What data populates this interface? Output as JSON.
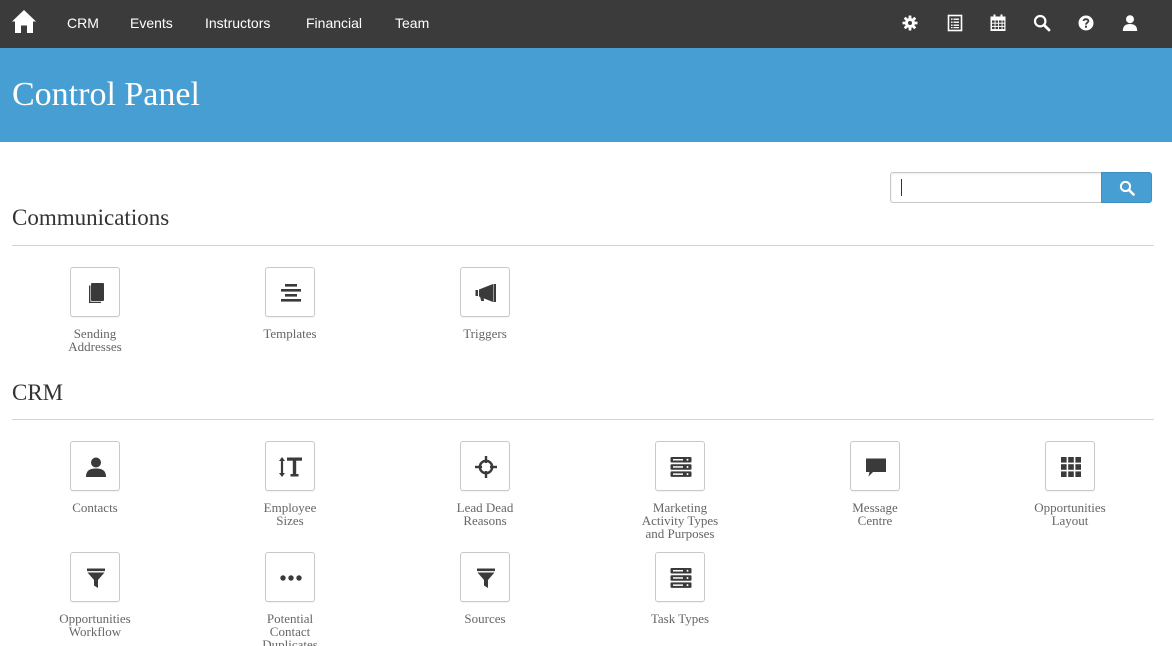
{
  "nav": {
    "home_icon": "home-icon",
    "links": [
      "CRM",
      "Events",
      "Instructors",
      "Financial",
      "Team"
    ],
    "right_icons": [
      "gear-icon",
      "list-icon",
      "calendar-icon",
      "search-icon",
      "help-icon",
      "user-icon"
    ]
  },
  "header": {
    "title": "Control Panel"
  },
  "search": {
    "value": "",
    "placeholder": "",
    "button_icon": "search-icon"
  },
  "sections": [
    {
      "title": "Communications",
      "items": [
        {
          "lines": [
            "Sending",
            "Addresses"
          ],
          "icon": "book-icon"
        },
        {
          "lines": [
            "Templates"
          ],
          "icon": "align-center-icon"
        },
        {
          "lines": [
            "Triggers"
          ],
          "icon": "megaphone-icon"
        }
      ]
    },
    {
      "title": "CRM",
      "items": [
        {
          "lines": [
            "Contacts"
          ],
          "icon": "user-icon"
        },
        {
          "lines": [
            "Employee",
            "Sizes"
          ],
          "icon": "text-height-icon"
        },
        {
          "lines": [
            "Lead Dead",
            "Reasons"
          ],
          "icon": "crosshairs-icon"
        },
        {
          "lines": [
            "Marketing",
            "Activity Types",
            "and Purposes"
          ],
          "icon": "server-icon"
        },
        {
          "lines": [
            "Message",
            "Centre"
          ],
          "icon": "comment-icon"
        },
        {
          "lines": [
            "Opportunities",
            "Layout"
          ],
          "icon": "grid-icon"
        },
        {
          "lines": [
            "Opportunities",
            "Workflow"
          ],
          "icon": "filter-icon"
        },
        {
          "lines": [
            "Potential",
            "Contact",
            "Duplicates"
          ],
          "icon": "ellipsis-icon"
        },
        {
          "lines": [
            "Sources"
          ],
          "icon": "filter-icon"
        },
        {
          "lines": [
            "Task Types"
          ],
          "icon": "server-icon"
        }
      ]
    }
  ]
}
